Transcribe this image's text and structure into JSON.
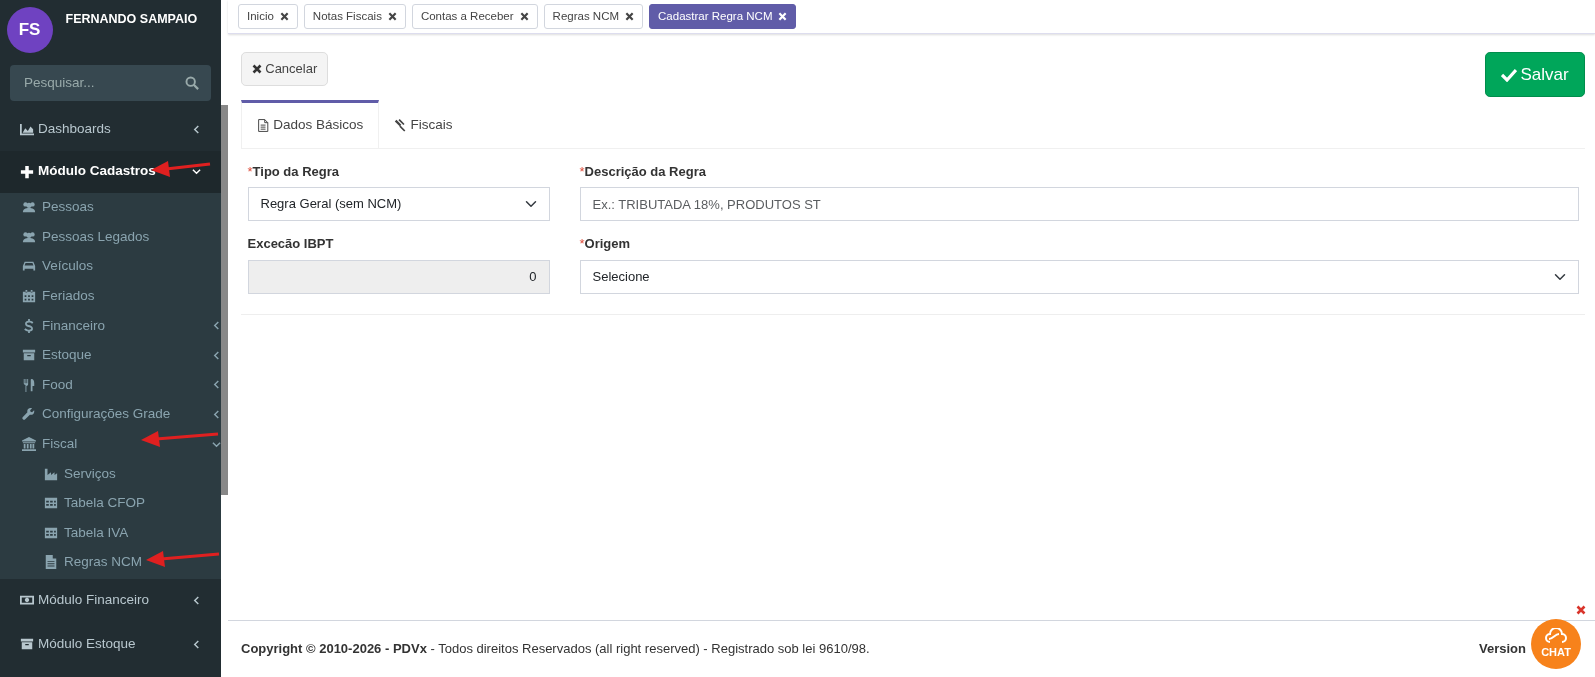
{
  "user": {
    "initials": "FS",
    "name": "FERNANDO SAMPAIO"
  },
  "search": {
    "placeholder": "Pesquisar..."
  },
  "sidebar": {
    "items": [
      {
        "label": "Dashboards",
        "expanded": false,
        "selected": false,
        "marked": false
      },
      {
        "label": "Módulo Cadastros",
        "expanded": true,
        "selected": true,
        "marked": true,
        "children": [
          {
            "label": "Pessoas",
            "marked": false
          },
          {
            "label": "Pessoas Legados",
            "marked": false
          },
          {
            "label": "Veículos",
            "marked": false
          },
          {
            "label": "Feriados",
            "marked": false
          },
          {
            "label": "Financeiro",
            "expanded": false,
            "marked": false
          },
          {
            "label": "Estoque",
            "expanded": false,
            "marked": false
          },
          {
            "label": "Food",
            "expanded": false,
            "marked": false
          },
          {
            "label": "Configurações Grade",
            "expanded": false,
            "marked": false
          },
          {
            "label": "Fiscal",
            "expanded": true,
            "marked": true,
            "children": [
              {
                "label": "Serviços",
                "marked": false
              },
              {
                "label": "Tabela CFOP",
                "marked": false
              },
              {
                "label": "Tabela IVA",
                "marked": false
              },
              {
                "label": "Regras NCM",
                "marked": true
              }
            ]
          }
        ]
      },
      {
        "label": "Módulo Financeiro",
        "expanded": false,
        "selected": false,
        "marked": false
      },
      {
        "label": "Módulo Estoque",
        "expanded": false,
        "selected": false,
        "marked": false
      }
    ]
  },
  "open_tabs": [
    {
      "label": "Inicio",
      "selected": false
    },
    {
      "label": "Notas Fiscais",
      "selected": false
    },
    {
      "label": "Contas a Receber",
      "selected": false
    },
    {
      "label": "Regras NCM",
      "selected": false
    },
    {
      "label": "Cadastrar Regra NCM",
      "selected": true
    }
  ],
  "buttons": {
    "cancel": "Cancelar",
    "save": "Salvar"
  },
  "form_tabs": [
    {
      "label": "Dados Básicos",
      "selected": true
    },
    {
      "label": "Fiscais",
      "selected": false
    }
  ],
  "fields": [
    {
      "kind": "select",
      "required_mark": "*",
      "label": "Tipo da Regra",
      "value": "Regra Geral (sem NCM)"
    },
    {
      "kind": "text",
      "required_mark": "*",
      "label": "Descrição da Regra",
      "placeholder": "Ex.: TRIBUTADA 18%, PRODUTOS ST"
    },
    {
      "kind": "number",
      "label": "Excecão IBPT",
      "value": "0",
      "disabled": true
    },
    {
      "kind": "select",
      "required_mark": "*",
      "label": "Origem",
      "value": "Selecione"
    }
  ],
  "footer": {
    "copyright": "**Copyright © 2010-2026 - PDVx** - Todos direitos Reservados (all right reserved) - Registrado sob lei 9610/98.",
    "version_label": "Version"
  },
  "chat": {
    "label": "CHAT"
  }
}
